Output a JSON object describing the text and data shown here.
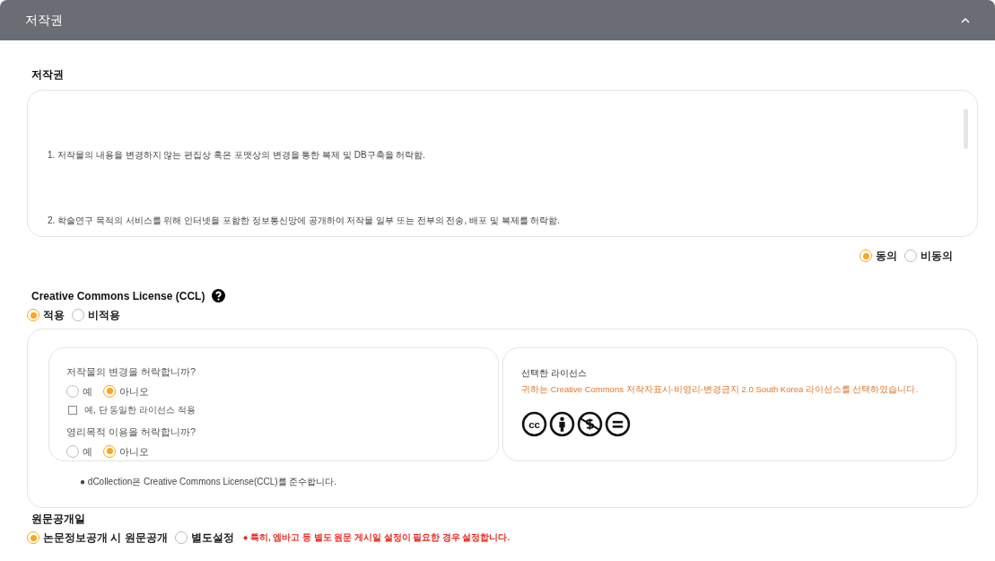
{
  "header": {
    "title": "저작권",
    "expanded": true
  },
  "copyright": {
    "label": "저작권",
    "paragraphs": [
      "1. 저작물의 내용을 변경하지 않는 편집상 혹은 포맷상의 변경을 통한 복제 및 DB구축을 허락함.",
      "2. 학술연구 목적의 서비스를 위해 인터넷을 포함한 정보통신망에 공개하여 저작물 일부 또는 전부의 전송, 배포 및 복제를 허락함."
    ],
    "consent": [
      {
        "label": "동의",
        "selected": true
      },
      {
        "label": "비동의",
        "selected": false
      }
    ]
  },
  "ccl": {
    "title": "Creative Commons License (CCL)",
    "apply": [
      {
        "label": "적용",
        "selected": true
      },
      {
        "label": "비적용",
        "selected": false
      }
    ],
    "modification": {
      "question": "저작물의 변경을 허락합니까?",
      "options": [
        {
          "label": "예",
          "selected": false
        },
        {
          "label": "아니오",
          "selected": true
        }
      ],
      "share_alike": {
        "label": "예, 단 동일한 라이선스 적용",
        "checked": false
      }
    },
    "commercial": {
      "question": "영리목적 이용을 허락합니까?",
      "options": [
        {
          "label": "예",
          "selected": false
        },
        {
          "label": "아니오",
          "selected": true
        }
      ]
    },
    "selected_license": {
      "title": "선택한 라이선스",
      "message": "귀하는 Creative Commons 저작자표시-비영리-변경금지 2.0 South Korea 라이선스를 선택하였습니다.",
      "icons": [
        {
          "kind": "cc"
        },
        {
          "kind": "by"
        },
        {
          "kind": "nc"
        },
        {
          "kind": "nd"
        }
      ]
    },
    "note": "● dCollection은 Creative Commons License(CCL)를 준수합니다."
  },
  "release": {
    "label": "원문공개일",
    "options": [
      {
        "label": "논문정보공개 시 원문공개",
        "selected": true
      },
      {
        "label": "별도설정",
        "selected": false
      }
    ],
    "note": "● 특히, 엠바고 등 별도 원문 게시일 설정이 필요한 경우 설정합니다."
  }
}
